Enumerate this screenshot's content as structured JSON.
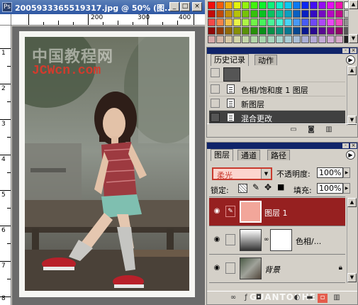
{
  "document": {
    "title": "2005933365519317.jpg @ 50% (图...",
    "ruler_top": [
      "200",
      "300",
      "400"
    ],
    "ruler_left": [
      "1",
      "2",
      "3",
      "4",
      "5",
      "6",
      "7",
      "8"
    ],
    "watermark_cn": "中国教程网",
    "watermark_en": "JCWcn.com",
    "window_buttons": {
      "minimize": "_",
      "maximize": "□",
      "close": "×"
    }
  },
  "history": {
    "tabs": [
      "历史记录",
      "动作"
    ],
    "items": [
      {
        "label": "色相/饱和度 1 图层"
      },
      {
        "label": "新图层"
      },
      {
        "label": "混合更改"
      }
    ]
  },
  "layers": {
    "tabs": [
      "图层",
      "通道",
      "路径"
    ],
    "blend_mode": "柔光",
    "opacity_label": "不透明度:",
    "opacity_value": "100%",
    "lock_label": "锁定:",
    "fill_label": "填充:",
    "fill_value": "100%",
    "items": [
      {
        "name": "图层 1"
      },
      {
        "name": "色相/..."
      },
      {
        "name": "背景"
      }
    ],
    "footer_logo": "GUANTOUHE"
  },
  "colors": {
    "selected_layer": "#962020",
    "blend_highlight": "#c83a2e",
    "title_bar": "#2e57a3"
  },
  "icons": [
    "ps-document-icon",
    "eye-icon",
    "brush-icon",
    "chain-link-icon",
    "lock-icon",
    "palette-menu-icon",
    "new-document-icon",
    "camera-icon",
    "trash-icon",
    "fx-icon",
    "mask-icon",
    "folder-icon",
    "adjustment-icon"
  ]
}
